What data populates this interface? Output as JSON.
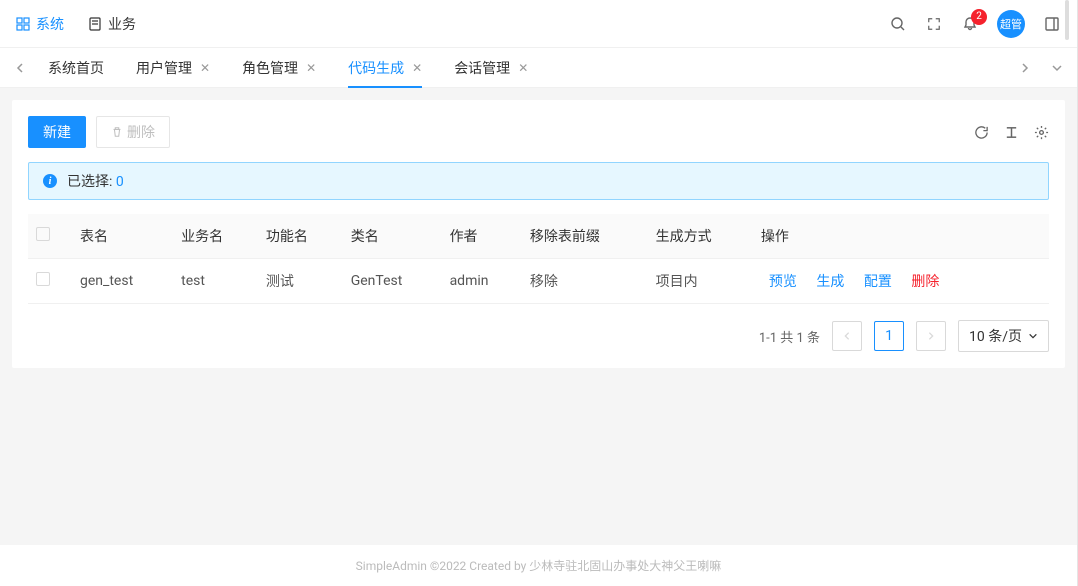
{
  "header": {
    "nav": [
      {
        "label": "系统",
        "active": true,
        "icon": "grid-icon"
      },
      {
        "label": "业务",
        "active": false,
        "icon": "file-icon"
      }
    ],
    "notification_count": "2",
    "avatar_label": "超管"
  },
  "tabs": [
    {
      "label": "系统首页",
      "closable": false,
      "active": false
    },
    {
      "label": "用户管理",
      "closable": true,
      "active": false
    },
    {
      "label": "角色管理",
      "closable": true,
      "active": false
    },
    {
      "label": "代码生成",
      "closable": true,
      "active": true
    },
    {
      "label": "会话管理",
      "closable": true,
      "active": false
    }
  ],
  "toolbar": {
    "create_label": "新建",
    "delete_label": "删除"
  },
  "alert": {
    "text": "已选择:",
    "count": "0"
  },
  "table": {
    "headers": [
      "表名",
      "业务名",
      "功能名",
      "类名",
      "作者",
      "移除表前缀",
      "生成方式",
      "操作"
    ],
    "rows": [
      {
        "table_name": "gen_test",
        "biz_name": "test",
        "func_name": "测试",
        "class_name": "GenTest",
        "author": "admin",
        "prefix": "移除",
        "gen_type": "项目内"
      }
    ],
    "actions": {
      "preview": "预览",
      "generate": "生成",
      "configure": "配置",
      "delete": "删除"
    }
  },
  "pagination": {
    "info": "1-1 共 1 条",
    "current": "1",
    "page_size": "10 条/页"
  },
  "footer": {
    "text": "SimpleAdmin ©2022 Created by 少林寺驻北固山办事处大神父王喇嘛"
  }
}
